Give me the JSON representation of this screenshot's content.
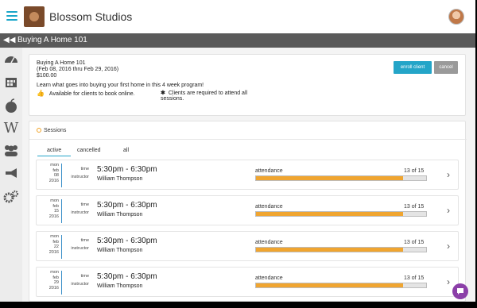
{
  "app": {
    "brand": "Blossom Studios"
  },
  "titlebar": {
    "title": "Buying A Home 101"
  },
  "sidebar": {
    "icons": [
      "dashboard-icon",
      "calendar-icon",
      "apple-icon",
      "workout-icon",
      "clients-icon",
      "megaphone-icon",
      "gears-icon"
    ]
  },
  "program": {
    "name": "Buying A Home 101",
    "dates": "(Feb 08, 2016 thru Feb 29, 2016)",
    "price": "$100.00",
    "description": "Learn what goes into buying your first home in this 4 week program!",
    "booking_note": "Available for clients to book online.",
    "attend_note_1": "Clients are required to attend all",
    "attend_note_2": "sessions.",
    "enroll_label": "enroll client",
    "cancel_label": "cancel"
  },
  "sessions": {
    "heading": "Sessions",
    "tabs": [
      "active",
      "cancelled",
      "all"
    ],
    "time_label": "time",
    "instructor_label": "instructor",
    "attendance_label": "attendance",
    "items": [
      {
        "dow": "mon",
        "month": "feb",
        "day": "08",
        "year": "2016",
        "time": "5:30pm - 6:30pm",
        "instructor": "William Thompson",
        "count": "13 of 15",
        "attended": 13,
        "capacity": 15
      },
      {
        "dow": "mon",
        "month": "feb",
        "day": "15",
        "year": "2016",
        "time": "5:30pm - 6:30pm",
        "instructor": "William Thompson",
        "count": "13 of 15",
        "attended": 13,
        "capacity": 15
      },
      {
        "dow": "mon",
        "month": "feb",
        "day": "22",
        "year": "2016",
        "time": "5:30pm - 6:30pm",
        "instructor": "William Thompson",
        "count": "13 of 15",
        "attended": 13,
        "capacity": 15
      },
      {
        "dow": "mon",
        "month": "feb",
        "day": "29",
        "year": "2016",
        "time": "5:30pm - 6:30pm",
        "instructor": "William Thompson",
        "count": "13 of 15",
        "attended": 13,
        "capacity": 15
      }
    ]
  },
  "colors": {
    "accent": "#24a5c8",
    "progress": "#f0a530",
    "help": "#8b3fa8"
  }
}
